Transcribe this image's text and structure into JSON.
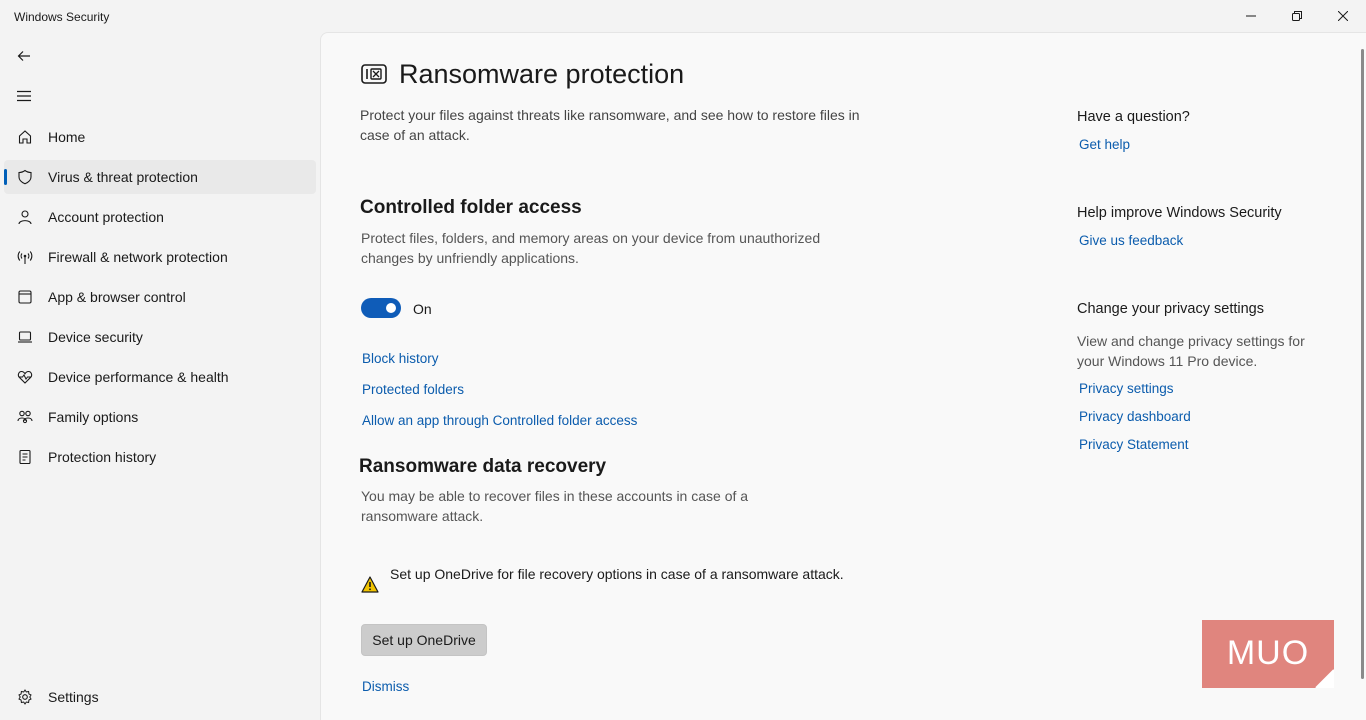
{
  "window": {
    "title": "Windows Security",
    "minimize_icon": "minimize-icon",
    "maximize_icon": "restore-icon",
    "close_icon": "close-icon"
  },
  "sidebar": {
    "back_icon": "back-arrow-icon",
    "menu_icon": "hamburger-menu-icon",
    "items": [
      {
        "label": "Home",
        "icon": "home-icon"
      },
      {
        "label": "Virus & threat protection",
        "icon": "shield-icon",
        "active": true
      },
      {
        "label": "Account protection",
        "icon": "person-icon"
      },
      {
        "label": "Firewall & network protection",
        "icon": "antenna-icon"
      },
      {
        "label": "App & browser control",
        "icon": "app-window-icon"
      },
      {
        "label": "Device security",
        "icon": "laptop-icon"
      },
      {
        "label": "Device performance & health",
        "icon": "heart-pulse-icon"
      },
      {
        "label": "Family options",
        "icon": "family-icon"
      },
      {
        "label": "Protection history",
        "icon": "history-icon"
      }
    ],
    "settings": {
      "label": "Settings",
      "icon": "gear-icon"
    }
  },
  "main": {
    "page_icon": "ransomware-icon",
    "title": "Ransomware protection",
    "description": "Protect your files against threats like ransomware, and see how to restore files in case of an attack.",
    "controlled_folder": {
      "heading": "Controlled folder access",
      "description": "Protect files, folders, and memory areas on your device from unauthorized changes by unfriendly applications.",
      "toggle_state": "On",
      "toggle_on": true,
      "links": [
        "Block history",
        "Protected folders",
        "Allow an app through Controlled folder access"
      ]
    },
    "recovery": {
      "heading": "Ransomware data recovery",
      "description": "You may be able to recover files in these accounts in case of a ransomware attack.",
      "warning_icon": "warning-icon",
      "warning_text": "Set up OneDrive for file recovery options in case of a ransomware attack.",
      "button_label": "Set up OneDrive",
      "dismiss_label": "Dismiss"
    }
  },
  "aside": {
    "question": {
      "heading": "Have a question?",
      "link": "Get help"
    },
    "improve": {
      "heading": "Help improve Windows Security",
      "link": "Give us feedback"
    },
    "privacy": {
      "heading": "Change your privacy settings",
      "description": "View and change privacy settings for your Windows 11 Pro device.",
      "links": [
        "Privacy settings",
        "Privacy dashboard",
        "Privacy Statement"
      ]
    }
  },
  "watermark": {
    "text": "MUO",
    "color": "#e0857e"
  },
  "colors": {
    "accent": "#0f5cb8",
    "link": "#0b5cad",
    "warning": "#f2c400"
  }
}
